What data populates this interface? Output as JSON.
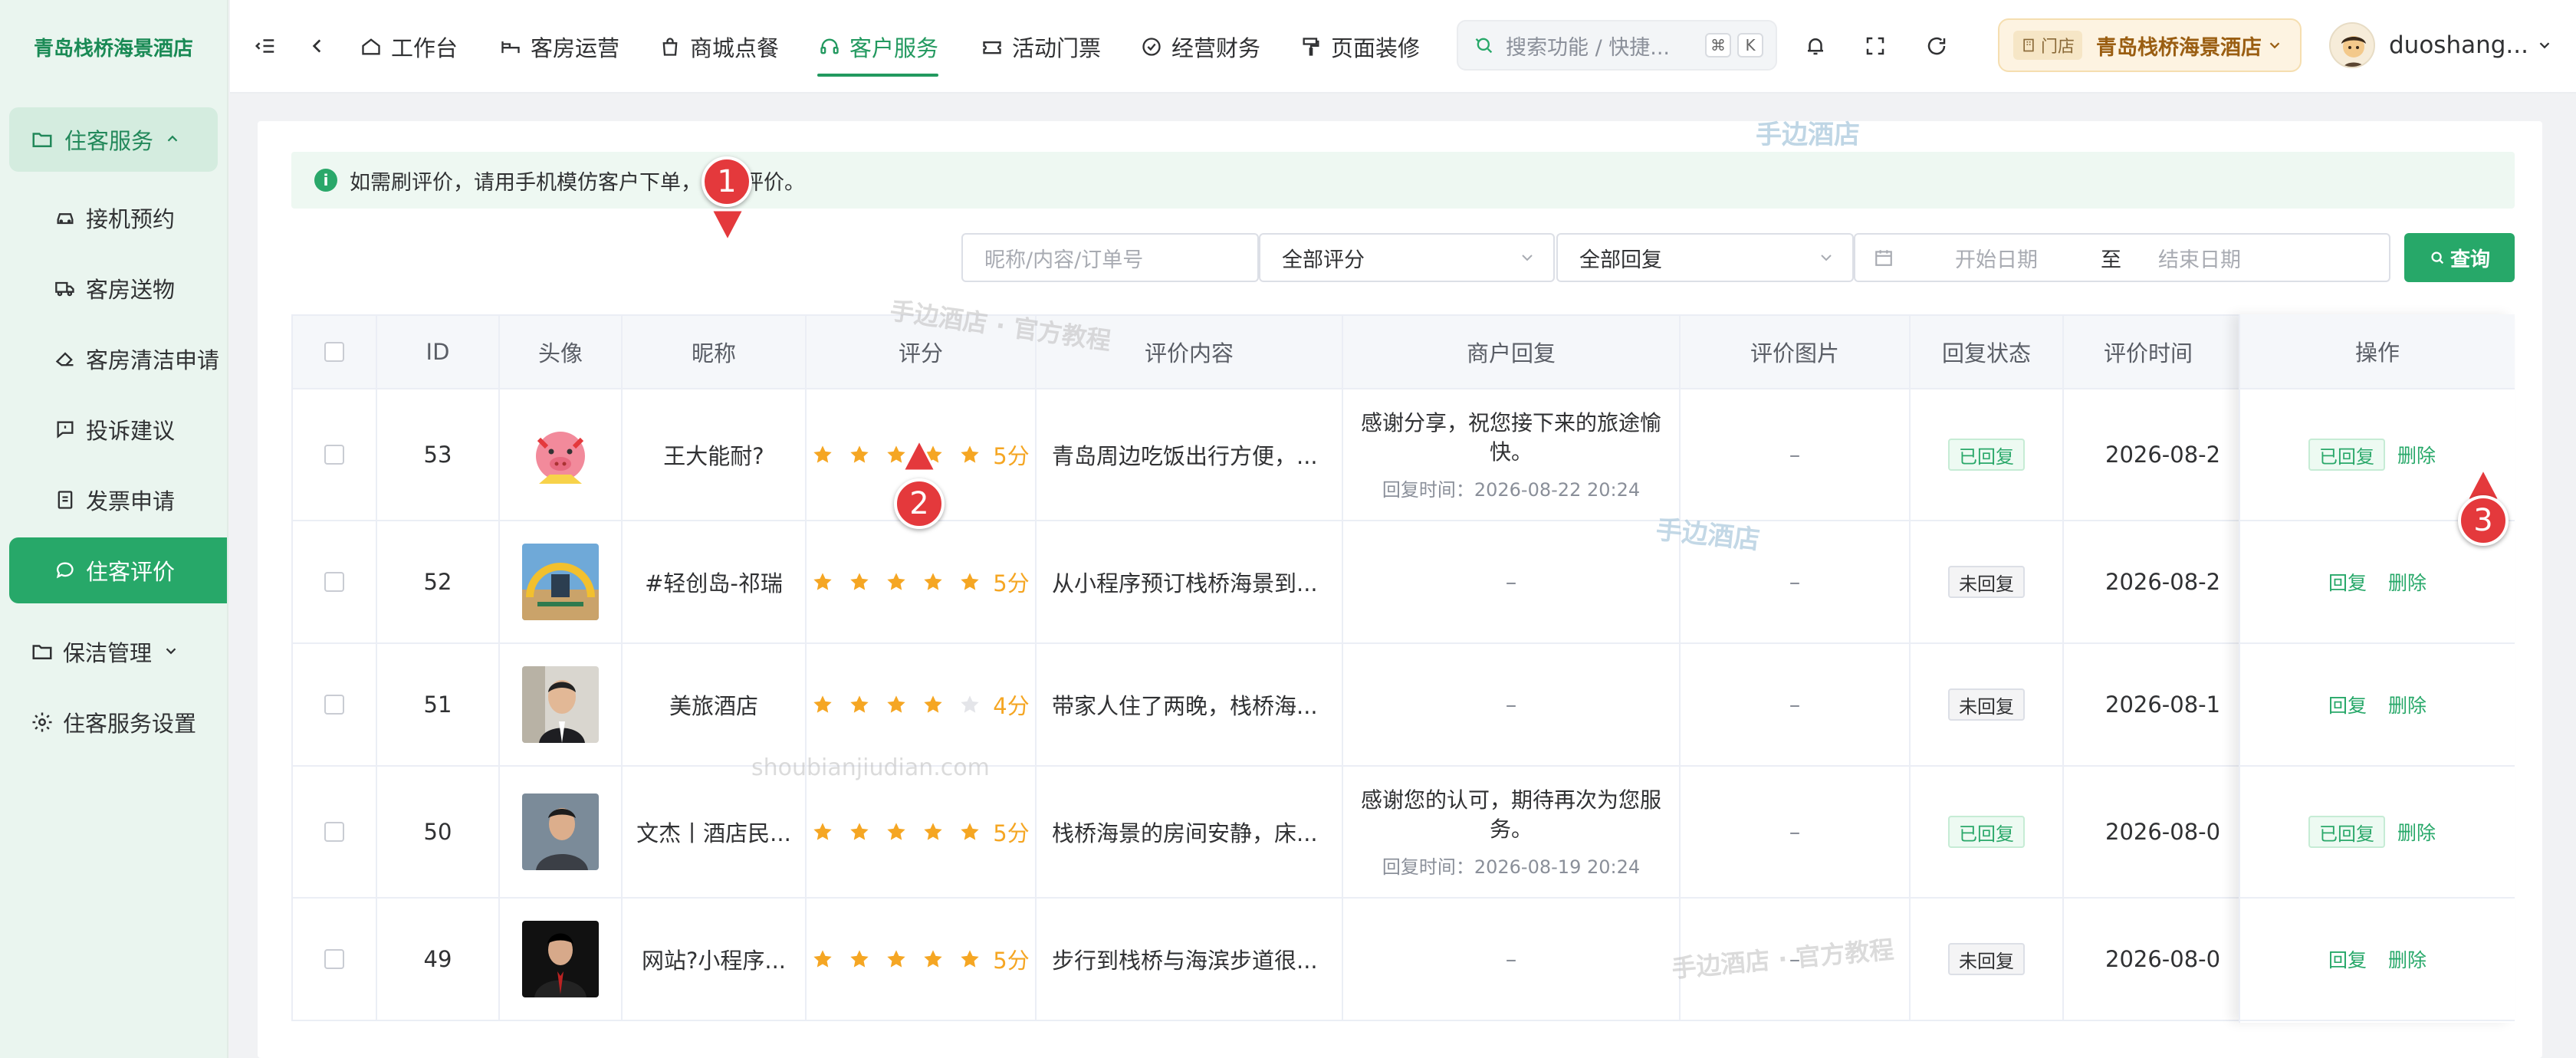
{
  "app": {
    "brand": "青岛栈桥海景酒店"
  },
  "sidebar": {
    "group_open": "住客服务",
    "items": [
      "接机预约",
      "客房送物",
      "客房清洁申请",
      "投诉建议",
      "发票申请",
      "住客评价"
    ],
    "active": "住客评价",
    "group_closed": "保洁管理",
    "bottom_item": "住客服务设置"
  },
  "header": {
    "nav": [
      "工作台",
      "客房运营",
      "商城点餐",
      "客户服务",
      "活动门票",
      "经营财务",
      "页面装修"
    ],
    "active_nav": "客户服务",
    "search_placeholder": "搜索功能 / 快捷...",
    "kbd": [
      "⌘",
      "K"
    ],
    "store_tag": "门店",
    "store_name": "青岛栈桥海景酒店",
    "username": "duoshang..."
  },
  "notice": "如需刷评价，请用手机模仿客户下单，再去评价。",
  "filters": {
    "keyword_placeholder": "昵称/内容/订单号",
    "rating_select": "全部评分",
    "reply_select": "全部回复",
    "start_date": "开始日期",
    "to": "至",
    "end_date": "结束日期",
    "query_button": "查询"
  },
  "table": {
    "headers": [
      "ID",
      "头像",
      "昵称",
      "评分",
      "评价内容",
      "商户回复",
      "评价图片",
      "回复状态",
      "评价时间",
      "操作"
    ],
    "rows": [
      {
        "id": "53",
        "nick": "王大能耐?",
        "stars": 5,
        "score": "5分",
        "content": "青岛周边吃饭出行方便，...",
        "reply": "感谢分享，祝您接下来的旅途愉快。",
        "reply_time": "回复时间：2026-08-22 20:24",
        "images": "–",
        "status": "已回复",
        "time": "2026-08-2",
        "op": [
          "已回复",
          "删除"
        ]
      },
      {
        "id": "52",
        "nick": "#轻创岛-祁瑞",
        "stars": 5,
        "score": "5分",
        "content": "从小程序预订栈桥海景到...",
        "reply": "–",
        "reply_time": "",
        "images": "–",
        "status": "未回复",
        "time": "2026-08-2",
        "op": [
          "回复",
          "删除"
        ]
      },
      {
        "id": "51",
        "nick": "美旅酒店",
        "stars": 4,
        "score": "4分",
        "content": "带家人住了两晚，栈桥海...",
        "reply": "–",
        "reply_time": "",
        "images": "–",
        "status": "未回复",
        "time": "2026-08-1",
        "op": [
          "回复",
          "删除"
        ]
      },
      {
        "id": "50",
        "nick": "文杰丨酒店民...",
        "stars": 5,
        "score": "5分",
        "content": "栈桥海景的房间安静，床...",
        "reply": "感谢您的认可，期待再次为您服务。",
        "reply_time": "回复时间：2026-08-19 20:24",
        "images": "–",
        "status": "已回复",
        "time": "2026-08-0",
        "op": [
          "已回复",
          "删除"
        ]
      },
      {
        "id": "49",
        "nick": "网站?小程序...",
        "stars": 5,
        "score": "5分",
        "content": "步行到栈桥与海滨步道很...",
        "reply": "–",
        "reply_time": "",
        "images": "–",
        "status": "未回复",
        "time": "2026-08-0",
        "op": [
          "回复",
          "删除"
        ]
      }
    ]
  },
  "markers": [
    "1",
    "2",
    "3"
  ],
  "watermarks": [
    "手边酒店",
    "手边酒店 · 官方教程",
    "手边酒店",
    "shoubianjiudian.com",
    "手边酒店 · 官方教程"
  ],
  "colors": {
    "primary": "#27a869",
    "star": "#f5a623",
    "marker": "#e4393c"
  }
}
